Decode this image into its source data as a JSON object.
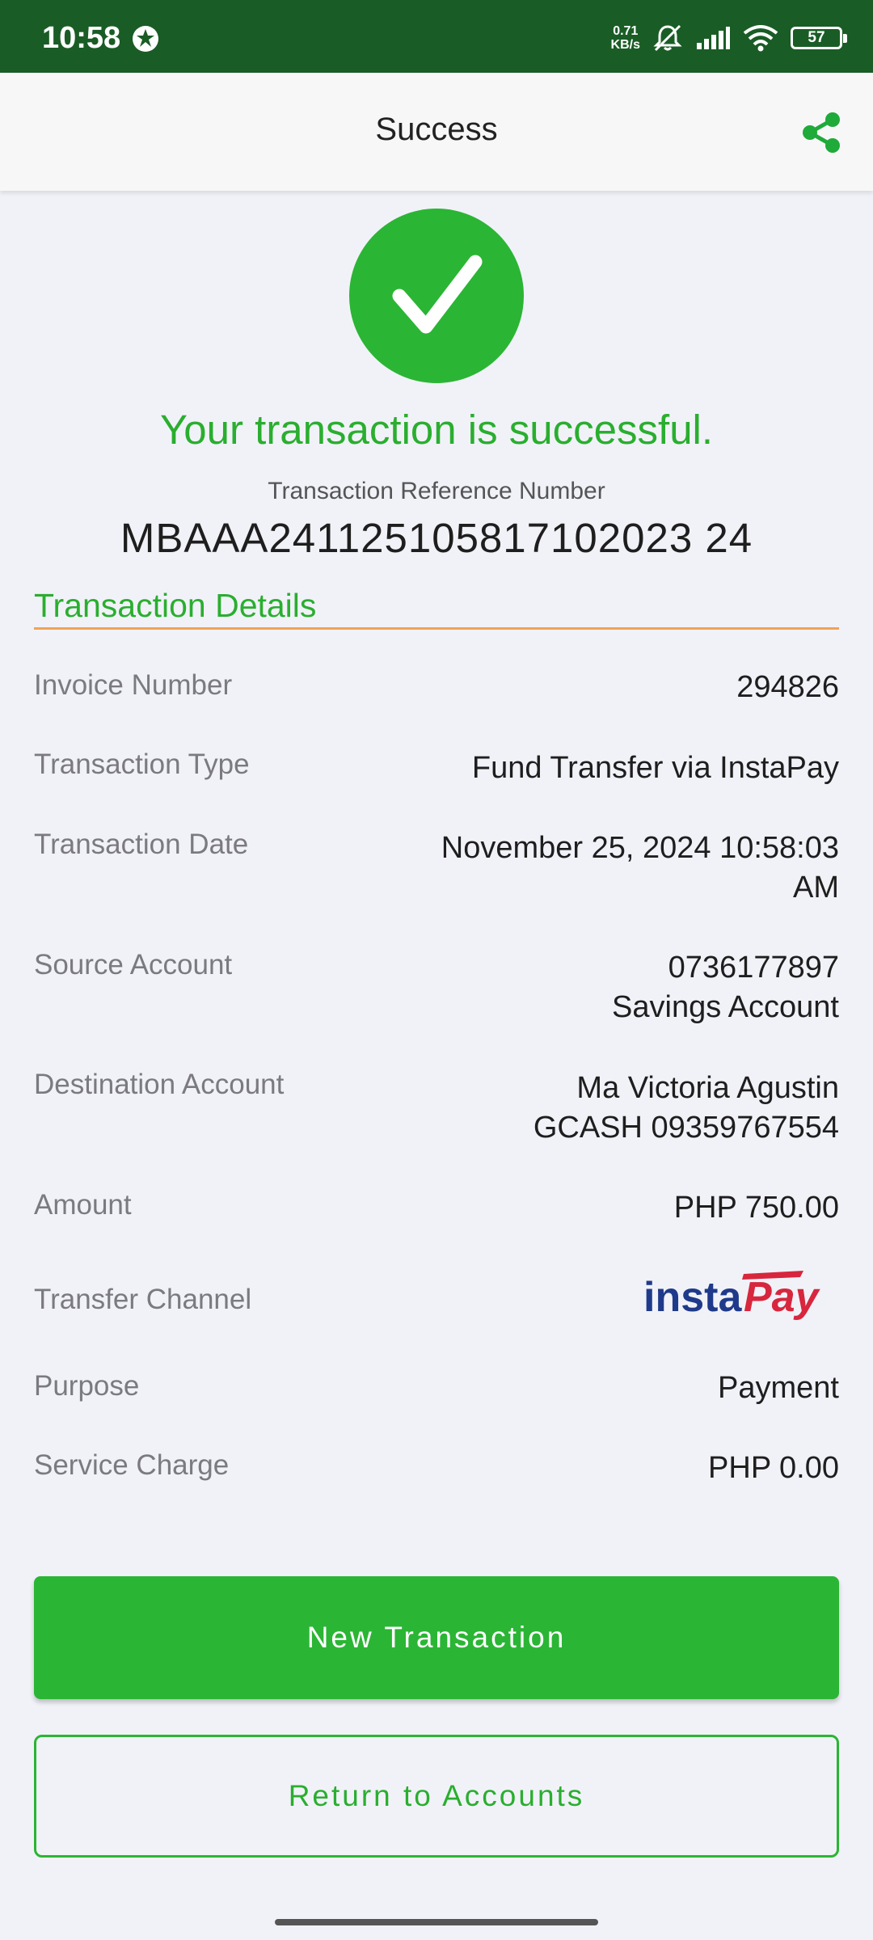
{
  "status_bar": {
    "time": "10:58",
    "net_speed_value": "0.71",
    "net_speed_unit": "KB/s",
    "battery": "57"
  },
  "header": {
    "title": "Success",
    "share_icon": "share-icon"
  },
  "result": {
    "message": "Your transaction is successful.",
    "ref_label": "Transaction Reference Number",
    "ref_number": "MBAAA241125105817102023 24"
  },
  "details": {
    "title": "Transaction Details",
    "invoice": {
      "label": "Invoice Number",
      "value": "294826"
    },
    "type": {
      "label": "Transaction Type",
      "value": "Fund Transfer via InstaPay"
    },
    "date": {
      "label": "Transaction Date",
      "line1": "November 25, 2024 10:58:03",
      "line2": "AM"
    },
    "source": {
      "label": "Source Account",
      "line1": "0736177897",
      "line2": "Savings Account"
    },
    "destination": {
      "label": "Destination Account",
      "line1": "Ma Victoria Agustin",
      "line2": "GCASH 09359767554"
    },
    "amount": {
      "label": "Amount",
      "value": "PHP 750.00"
    },
    "channel": {
      "label": "Transfer Channel",
      "logo_text_a": "insta",
      "logo_text_b": "Pay"
    },
    "purpose": {
      "label": "Purpose",
      "value": "Payment"
    },
    "charge": {
      "label": "Service Charge",
      "value": "PHP 0.00"
    }
  },
  "actions": {
    "new_transaction": "New Transaction",
    "return_accounts": "Return to Accounts"
  },
  "colors": {
    "accent_green": "#2bb534",
    "status_bar": "#1a5c25",
    "divider_orange": "#f0a35a"
  }
}
